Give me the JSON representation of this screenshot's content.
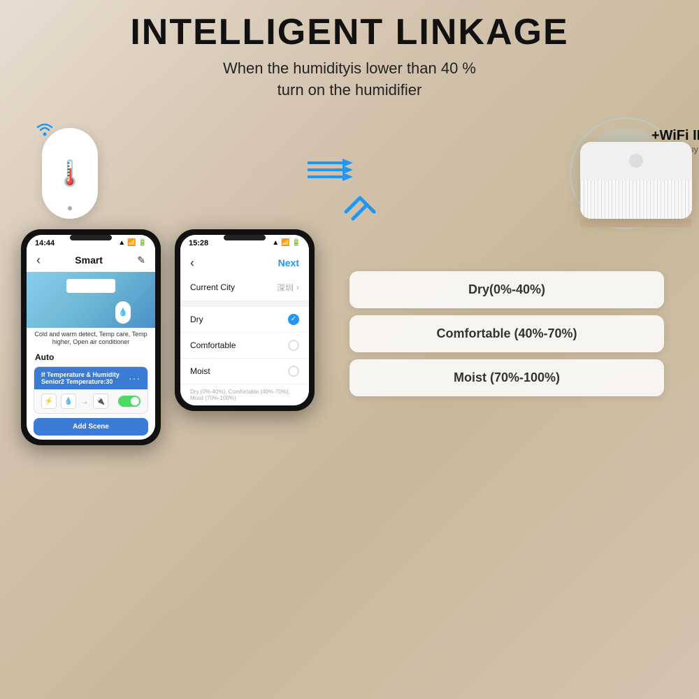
{
  "header": {
    "title": "INTELLIGENT LINKAGE",
    "subtitle_line1": "When the humidityis lower than 40 %",
    "subtitle_line2": "turn on the humidifier"
  },
  "wifi_remote": {
    "title": "+WiFi IR Remote",
    "subtitle": "(please buy it separately)"
  },
  "phone1": {
    "status_bar": {
      "time": "14:44",
      "signal": "▲"
    },
    "nav": {
      "back": "‹",
      "title": "Smart",
      "edit": "✎"
    },
    "caption": "Cold and warm detect, Temp care, Temp higher, Open air conditioner",
    "auto_label": "Auto",
    "automation": {
      "title": "If Temperature & Humidity Senior2 Temperature:30",
      "dots": "···"
    },
    "add_scene": "Add Scene"
  },
  "phone2": {
    "status_bar": {
      "time": "15:28",
      "signal": "▲"
    },
    "nav": {
      "back": "‹",
      "next": "Next"
    },
    "current_city_label": "Current City",
    "current_city_value": "深圳",
    "options": [
      {
        "label": "Dry",
        "selected": true
      },
      {
        "label": "Comfortable",
        "selected": false
      },
      {
        "label": "Moist",
        "selected": false
      }
    ],
    "hint": "Dry (0%-40%), Comfortable (40%-70%), Moist (70%-100%)"
  },
  "info_cards": [
    {
      "text": "Dry(0%-40%)"
    },
    {
      "text": "Comfortable (40%-70%)"
    },
    {
      "text": "Moist (70%-100%)"
    }
  ]
}
